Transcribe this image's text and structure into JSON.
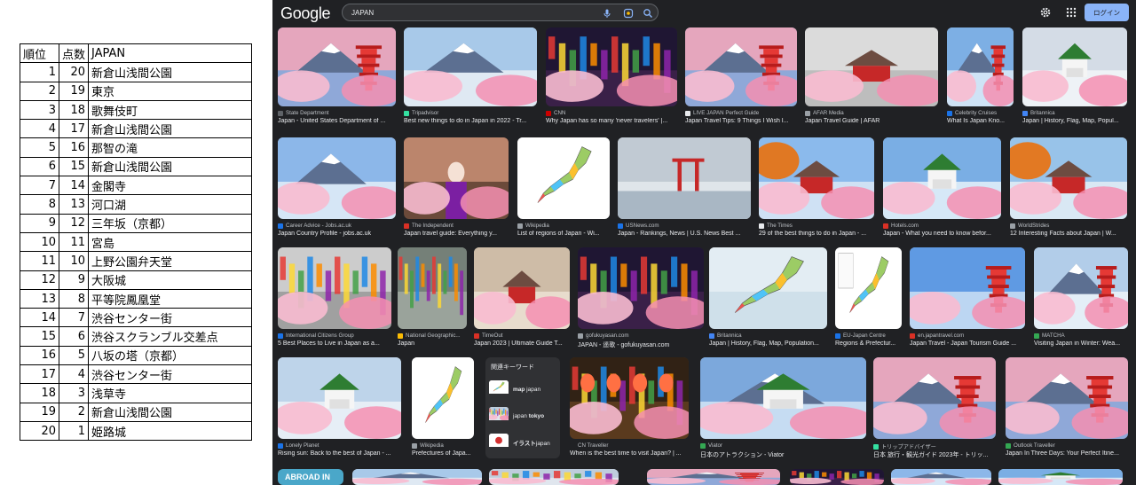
{
  "rank_table": {
    "headers": [
      "順位",
      "点数",
      "JAPAN"
    ],
    "rows": [
      [
        "1",
        "20",
        "新倉山浅間公園"
      ],
      [
        "2",
        "19",
        "東京"
      ],
      [
        "3",
        "18",
        "歌舞伎町"
      ],
      [
        "4",
        "17",
        "新倉山浅間公園"
      ],
      [
        "5",
        "16",
        "那智の滝"
      ],
      [
        "6",
        "15",
        "新倉山浅間公園"
      ],
      [
        "7",
        "14",
        "金閣寺"
      ],
      [
        "8",
        "13",
        "河口湖"
      ],
      [
        "9",
        "12",
        "三年坂（京都）"
      ],
      [
        "10",
        "11",
        "宮島"
      ],
      [
        "11",
        "10",
        "上野公園弁天堂"
      ],
      [
        "12",
        "9",
        "大阪城"
      ],
      [
        "13",
        "8",
        "平等院鳳凰堂"
      ],
      [
        "14",
        "7",
        "渋谷センター街"
      ],
      [
        "15",
        "6",
        "渋谷スクランブル交差点"
      ],
      [
        "16",
        "5",
        "八坂の塔（京都）"
      ],
      [
        "17",
        "4",
        "渋谷センター街"
      ],
      [
        "18",
        "3",
        "浅草寺"
      ],
      [
        "19",
        "2",
        "新倉山浅間公園"
      ],
      [
        "20",
        "1",
        "姫路城"
      ]
    ]
  },
  "header": {
    "logo": "Google",
    "search_value": "JAPAN",
    "login_label": "ログイン",
    "icons": [
      "mic-icon",
      "lens-icon",
      "search-icon",
      "settings-icon",
      "apps-icon"
    ]
  },
  "results": {
    "row1": [
      {
        "source": "State Department",
        "caption": "Japan - United States Department of ...",
        "fav": "#5f6368",
        "img": "pagoda"
      },
      {
        "source": "Tripadvisor",
        "caption": "Best new things to do in Japan in 2022 - Tr...",
        "fav": "#34e0a1",
        "img": "fuji-city"
      },
      {
        "source": "CNN",
        "caption": "Why Japan has so many 'never travelers' |...",
        "fav": "#cc0000",
        "img": "street-night"
      },
      {
        "source": "LIVE JAPAN Perfect Guide",
        "caption": "Japan Travel Tips: 9 Things I Wish I...",
        "fav": "#e8eaed",
        "img": "pagoda"
      },
      {
        "source": "AFAR Media",
        "caption": "Japan Travel Guide | AFAR",
        "fav": "#9aa0a6",
        "img": "temple-garden"
      },
      {
        "source": "Celebrity Cruises",
        "caption": "What Is Japan Kno...",
        "fav": "#1a73e8",
        "img": "pagoda-blue"
      },
      {
        "source": "Britannica",
        "caption": "Japan | History, Flag, Map, Popul...",
        "fav": "#4285f4",
        "img": "castle-snow"
      }
    ],
    "row2": [
      {
        "source": "Career Advice - Jobs.ac.uk",
        "caption": "Japan Country Profile - jobs.ac.uk",
        "fav": "#1a73e8",
        "img": "fuji-lake"
      },
      {
        "source": "The Independent",
        "caption": "Japan travel guide: Everything y...",
        "fav": "#d93025",
        "img": "geisha"
      },
      {
        "source": "Wikipedia",
        "caption": "List of regions of Japan - Wi...",
        "fav": "#9aa0a6",
        "img": "map"
      },
      {
        "source": "USNews.com",
        "caption": "Japan - Rankings, News | U.S. News Best ...",
        "fav": "#1a73e8",
        "img": "torii"
      },
      {
        "source": "The Times",
        "caption": "29 of the best things to do in Japan - ...",
        "fav": "#e8eaed",
        "img": "temple-blossom"
      },
      {
        "source": "Hotels.com",
        "caption": "Japan - What you need to know befor...",
        "fav": "#d93025",
        "img": "castle-blossom"
      },
      {
        "source": "WorldStrides",
        "caption": "12 Interesting Facts about Japan | W...",
        "fav": "#9aa0a6",
        "img": "autumn-temple"
      }
    ],
    "row3": [
      {
        "source": "International Citizens Group",
        "caption": "5 Best Places to Live in Japan as a...",
        "fav": "#1a73e8",
        "img": "street-day"
      },
      {
        "source": "National Geographic...",
        "caption": "Japan",
        "fav": "#fbbc04",
        "img": "crossing"
      },
      {
        "source": "TimeOut",
        "caption": "Japan 2023 | Ultimate Guide T...",
        "fav": "#d93025",
        "img": "yasaka"
      },
      {
        "source": "gofukuyasan.com",
        "caption": "JAPAN - 遥歌 - gofukuyasan.com",
        "fav": "#9aa0a6",
        "img": "street-night"
      },
      {
        "source": "Britannica",
        "caption": "Japan | History, Flag, Map, Population...",
        "fav": "#4285f4",
        "img": "map-old"
      },
      {
        "source": "EU-Japan Centre",
        "caption": "Regions & Prefectur...",
        "fav": "#1a73e8",
        "img": "map-legend"
      },
      {
        "source": "en.japantravel.com",
        "caption": "Japan Travel - Japan Tourism Guide ...",
        "fav": "#d93025",
        "img": "pagoda-red"
      },
      {
        "source": "MATCHA",
        "caption": "Visiting Japan in Winter: Wea...",
        "fav": "#34a853",
        "img": "pagoda-snow"
      }
    ],
    "row4": [
      {
        "source": "Lonely Planet",
        "caption": "Rising sun: Back to the best of Japan - ...",
        "fav": "#1a73e8",
        "img": "castle-pond"
      },
      {
        "source": "Wikipedia",
        "caption": "Prefectures of Japa...",
        "fav": "#9aa0a6",
        "img": "map"
      },
      {
        "source": "CN Traveller",
        "caption": "When is the best time to visit Japan? | ...",
        "fav": "#202124",
        "img": "lanterns"
      },
      {
        "source": "Viator",
        "caption": "日本のアトラクション - Viator",
        "fav": "#34a853",
        "img": "fuji-castle"
      },
      {
        "source": "トリップアドバイザー",
        "caption": "日本 旅行・観光ガイド 2023年 - トリッ...",
        "fav": "#34e0a1",
        "img": "pagoda"
      },
      {
        "source": "Outlook Traveller",
        "caption": "Japan In Three Days: Your Perfect Itine...",
        "fav": "#34a853",
        "img": "pagoda"
      }
    ],
    "row5_label": "ABROAD IN",
    "related": {
      "title": "関連キーワード",
      "items": [
        {
          "bold": "map",
          "rest": " japan",
          "img": "map"
        },
        {
          "pre": "japan ",
          "bold": "tokyo",
          "img": "tokyo"
        },
        {
          "bold": "イラスト",
          "rest": "japan",
          "img": "flag"
        }
      ]
    }
  }
}
